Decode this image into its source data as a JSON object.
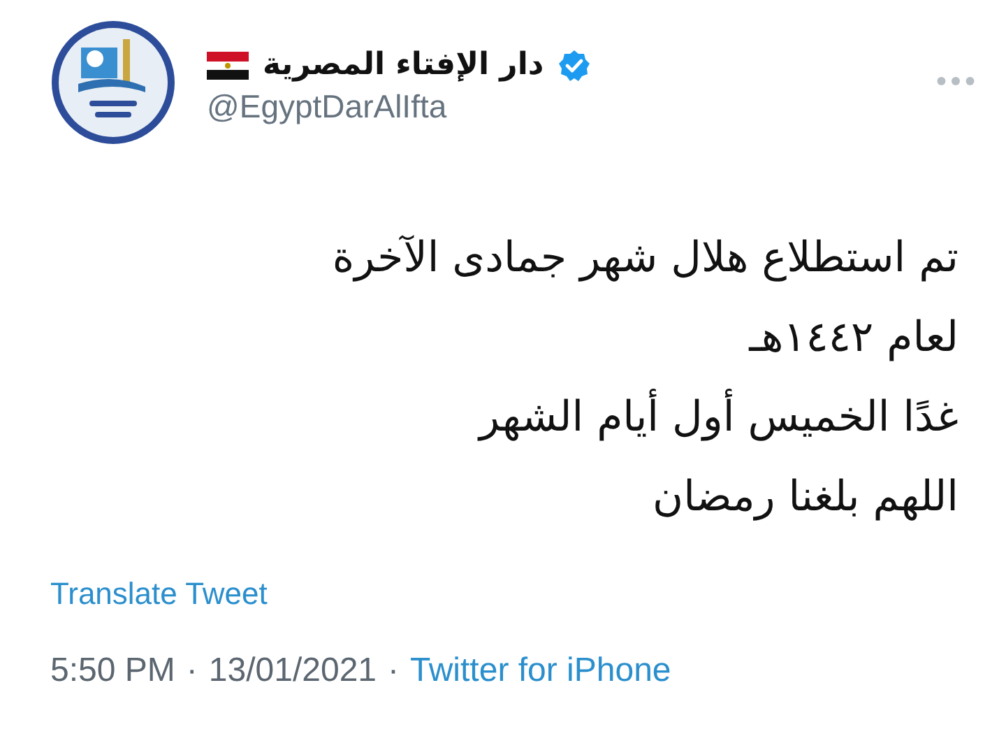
{
  "author": {
    "name": "دار الإفتاء المصرية",
    "verified": true,
    "handle": "@EgyptDarAlIfta"
  },
  "tweet": {
    "lines": [
      "تم استطلاع هلال شهر جمادى الآخرة لعام ١٤٤٢هـ",
      "غدًا الخميس أول أيام الشهر",
      "اللهم بلغنا رمضان"
    ]
  },
  "translate": "Translate Tweet",
  "meta": {
    "time": "5:50 PM",
    "separator_1": "·",
    "date": "13/01/2021",
    "separator_2": "·",
    "source": "Twitter for iPhone"
  }
}
